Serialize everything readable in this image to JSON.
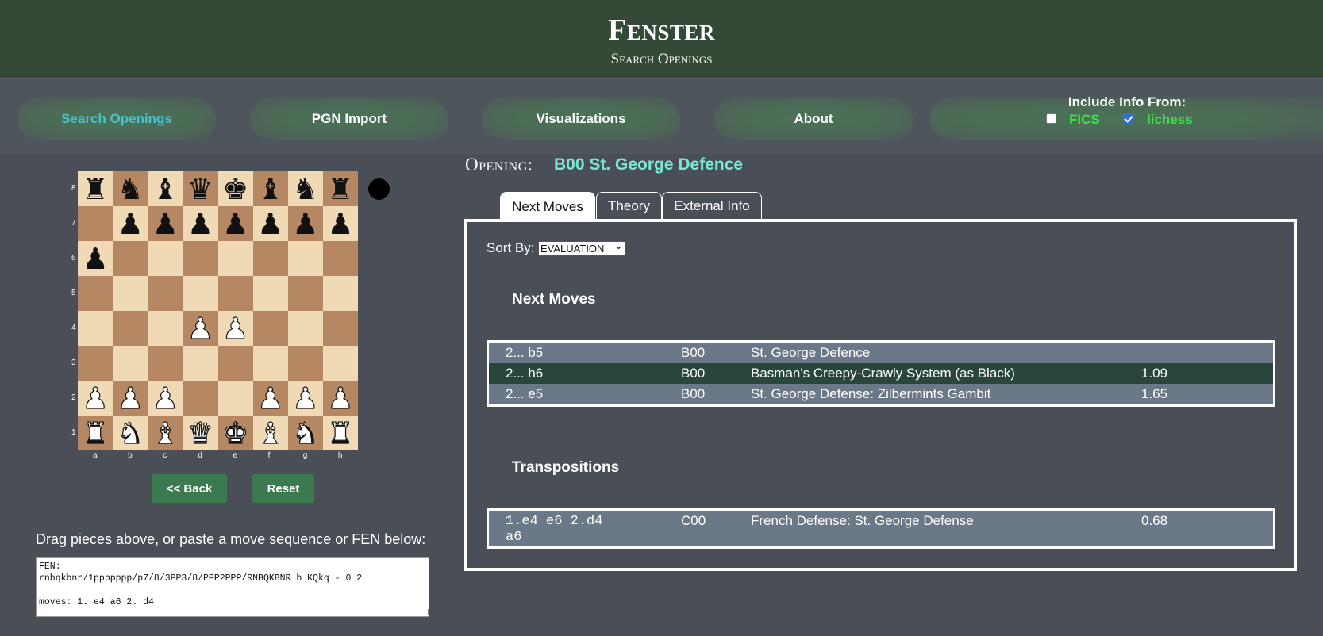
{
  "header": {
    "title": "Fenster",
    "subtitle": "Search Openings"
  },
  "nav": {
    "items": [
      {
        "label": "Search Openings",
        "active": true
      },
      {
        "label": "PGN Import"
      },
      {
        "label": "Visualizations"
      },
      {
        "label": "About"
      }
    ],
    "include_label": "Include Info From:",
    "sources": [
      {
        "label": "FICS",
        "checked": false
      },
      {
        "label": "lichess",
        "checked": true
      }
    ]
  },
  "board": {
    "ranks": [
      "8",
      "7",
      "6",
      "5",
      "4",
      "3",
      "2",
      "1"
    ],
    "files": [
      "a",
      "b",
      "c",
      "d",
      "e",
      "f",
      "g",
      "h"
    ],
    "fen_placement": "rnbqkbnr/1ppppppp/p7/8/3PP3/8/PPP2PPP/RNBQKBNR",
    "to_move": "black"
  },
  "controls": {
    "back_label": "<< Back",
    "reset_label": "Reset"
  },
  "instructions": "Drag pieces above, or paste a move sequence or FEN below:",
  "fen_text": "FEN:\nrnbqkbnr/1ppppppp/p7/8/3PP3/8/PPP2PPP/RNBQKBNR b KQkq - 0 2\n\nmoves: 1. e4 a6 2. d4",
  "opening": {
    "label": "Opening:",
    "name": "B00 St. George Defence"
  },
  "tabs": [
    {
      "label": "Next Moves",
      "active": true
    },
    {
      "label": "Theory"
    },
    {
      "label": "External Info"
    }
  ],
  "sort": {
    "label": "Sort By:",
    "selected": "EVALUATION"
  },
  "next_moves": {
    "title": "Next Moves",
    "rows": [
      {
        "move": "2... b5",
        "eco": "B00",
        "name": "St. George Defence",
        "eval": "",
        "selected": false
      },
      {
        "move": "2... h6",
        "eco": "B00",
        "name": "Basman's Creepy-Crawly System (as Black)",
        "eval": "1.09",
        "selected": true
      },
      {
        "move": "2... e5",
        "eco": "B00",
        "name": "St. George Defense: Zilbermints Gambit",
        "eval": "1.65",
        "selected": false
      }
    ]
  },
  "transpositions": {
    "title": "Transpositions",
    "rows": [
      {
        "move_line1": "1.e4 e6 2.d4",
        "move_line2": "a6",
        "eco": "C00",
        "name": "French Defense: St. George Defense",
        "eval": "0.68"
      }
    ]
  }
}
